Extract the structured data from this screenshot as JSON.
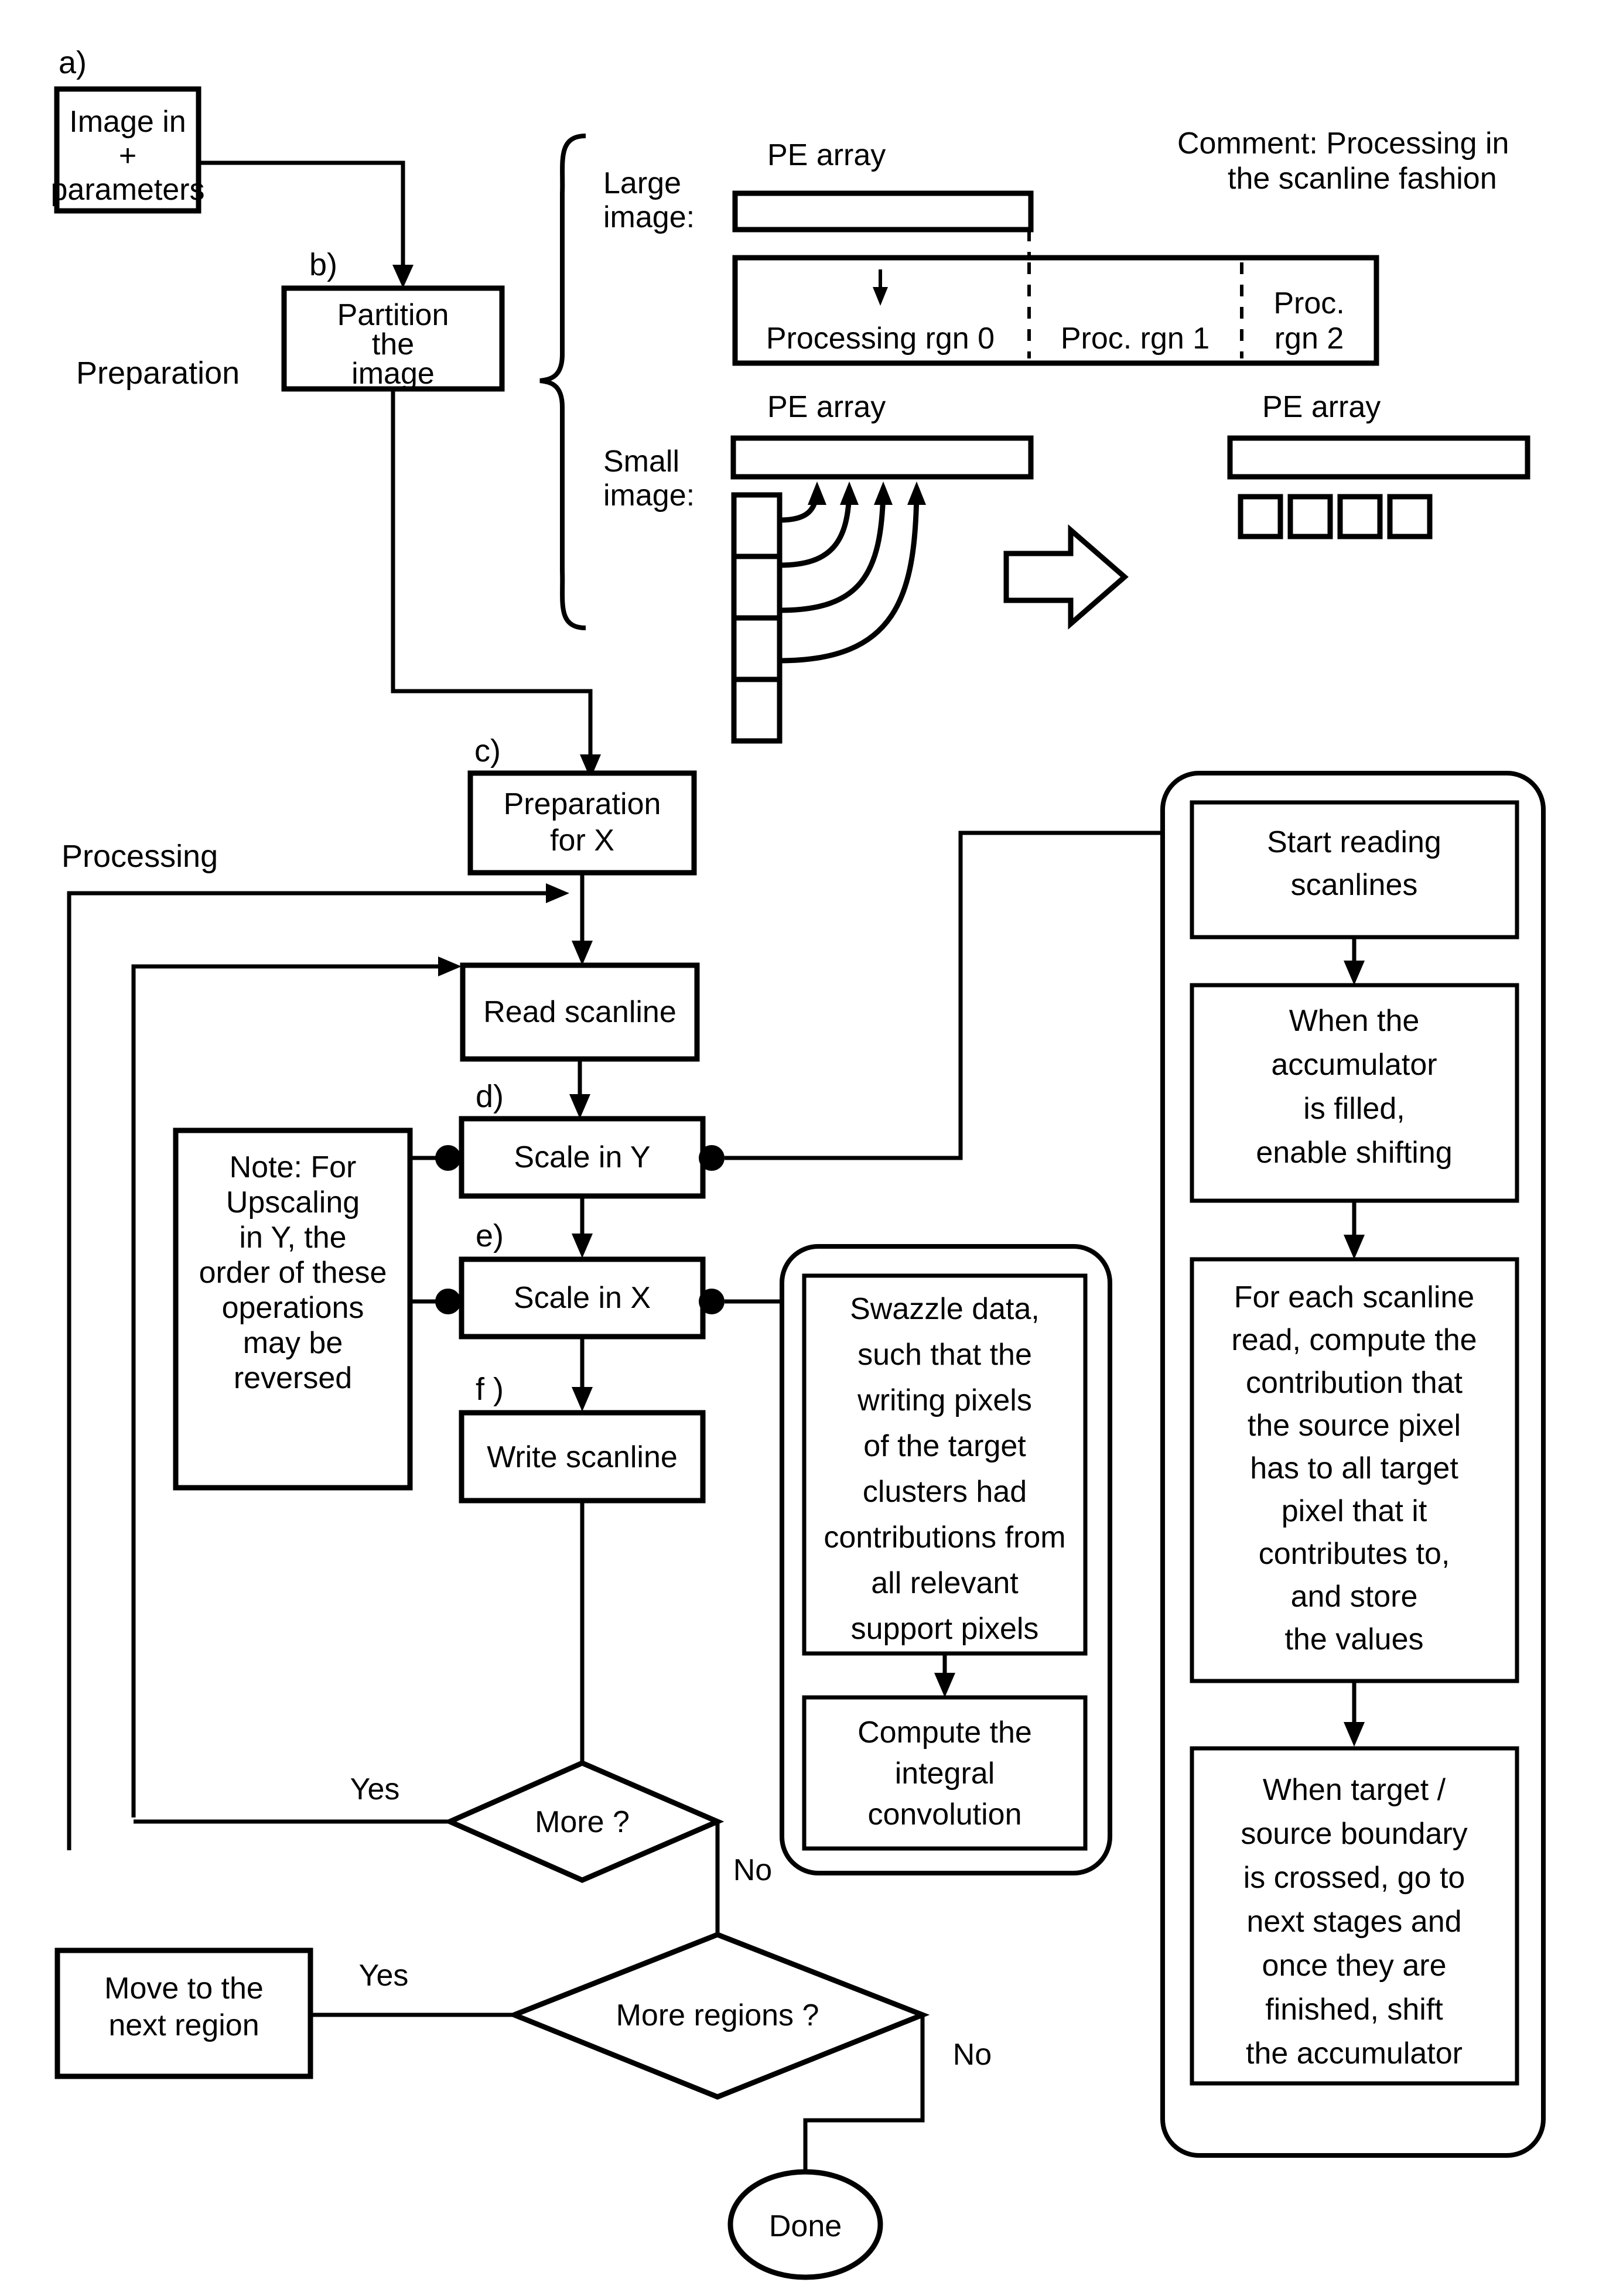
{
  "figure": {
    "step_labels": {
      "a": "a)",
      "b": "b)",
      "c": "c)",
      "d": "d)",
      "e": "e)",
      "f": "f )"
    },
    "section_labels": {
      "preparation": "Preparation",
      "processing": "Processing"
    }
  },
  "nodes": {
    "image_in": "Image in\n+\nparameters",
    "image_in_l1": "Image in",
    "image_in_l2": "+",
    "image_in_l3": "parameters",
    "partition_l1": "Partition",
    "partition_l2": "the",
    "partition_l3": "image",
    "preparation_for_x_l1": "Preparation",
    "preparation_for_x_l2": "for X",
    "read_scanline": "Read scanline",
    "scale_in_y": "Scale in Y",
    "scale_in_x": "Scale in X",
    "write_scanline": "Write scanline",
    "more": "More ?",
    "more_regions": "More regions ?",
    "move_next_region_l1": "Move to the",
    "move_next_region_l2": "next region",
    "done": "Done"
  },
  "note_box": {
    "lines": [
      "Note:  For",
      "Upscaling",
      "in Y, the",
      "order of these",
      "operations",
      "may be",
      "reversed"
    ]
  },
  "swazzle_panel": {
    "swazzle_lines": [
      "Swazzle data,",
      "such that the",
      "writing pixels",
      "of the target",
      "clusters had",
      "contributions from",
      "all relevant",
      "support pixels"
    ],
    "convolution_lines": [
      "Compute the",
      "integral",
      "convolution"
    ]
  },
  "scanline_panel": {
    "start_reading_lines": [
      "Start reading",
      "scanlines"
    ],
    "accumulator_lines": [
      "When the",
      "accumulator",
      "is filled,",
      "enable shifting"
    ],
    "for_each_lines": [
      "For each scanline",
      "read, compute the",
      "contribution that",
      "the source pixel",
      "has to all target",
      "pixel that it",
      "contributes to,",
      "and store",
      "the values"
    ],
    "boundary_lines": [
      "When target /",
      "source boundary",
      "is crossed, go to",
      "next stages and",
      "once they are",
      "finished, shift",
      "the accumulator"
    ]
  },
  "edges": {
    "yes_1": "Yes",
    "no_1": "No",
    "yes_2": "Yes",
    "no_2": "No"
  },
  "pe_diagram": {
    "comment_l1": "Comment: Processing in",
    "comment_l2": "the scanline fashion",
    "large_image_l1": "Large",
    "large_image_l2": "image:",
    "small_image_l1": "Small",
    "small_image_l2": "image:",
    "pe_array_top": "PE array",
    "pe_array_small_left": "PE array",
    "pe_array_small_right": "PE array",
    "regions": [
      "Processing rgn 0",
      "Proc. rgn 1",
      "Proc.\nrgn 2"
    ],
    "region_0": "Processing rgn 0",
    "region_1": "Proc. rgn 1",
    "region_2_l1": "Proc.",
    "region_2_l2": "rgn 2"
  },
  "colors": {
    "ink": "#000000",
    "paper": "#ffffff"
  }
}
